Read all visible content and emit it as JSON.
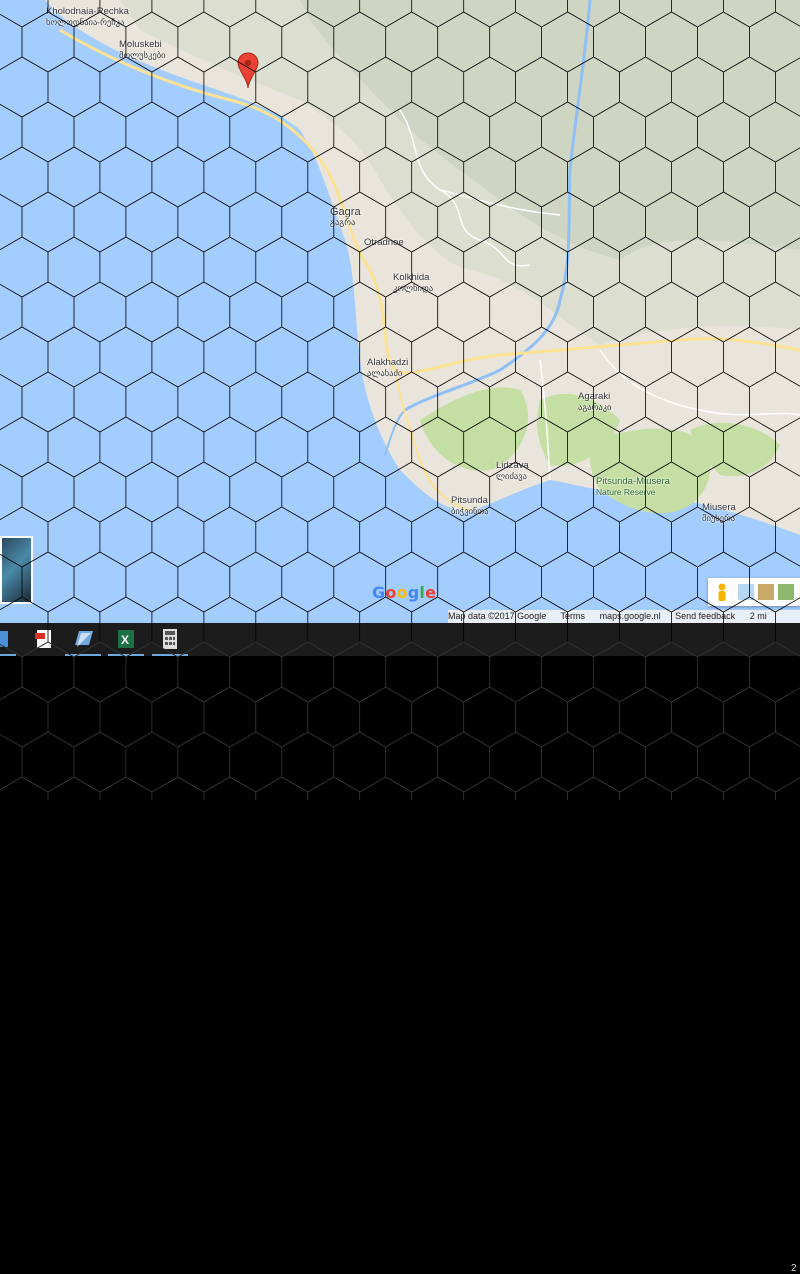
{
  "map": {
    "places": [
      {
        "id": "kholodnaia-rechka",
        "name": "Kholodnaia-Rechka",
        "local": "ხოლოდნაია-რეჩკა"
      },
      {
        "id": "moluskebi",
        "name": "Moluskebi",
        "local": "მოლუსკები"
      },
      {
        "id": "gagra",
        "name": "Gagra",
        "local": "გაგრა"
      },
      {
        "id": "otradnoe",
        "name": "Otradnoe",
        "local": ""
      },
      {
        "id": "kolkhida",
        "name": "Kolkhida",
        "local": "კოლხიდა"
      },
      {
        "id": "alakhadzi",
        "name": "Alakhadzi",
        "local": "ალახაძი"
      },
      {
        "id": "agaraki",
        "name": "Agaraki",
        "local": "აგარაკი"
      },
      {
        "id": "lidzava",
        "name": "Lidzava",
        "local": "ლიძავა"
      },
      {
        "id": "pitsunda",
        "name": "Pitsunda",
        "local": "ბიჭვინთა"
      },
      {
        "id": "pitsunda-miusera",
        "name": "Pitsunda-Miusera",
        "local": "Nature Reserve"
      },
      {
        "id": "miusera",
        "name": "Miusera",
        "local": "მიუსერა"
      }
    ],
    "marker": "red-pin-icon",
    "logo": "Google",
    "logo_colors": [
      "#4285F4",
      "#EA4335",
      "#FBBC05",
      "#4285F4",
      "#34A853",
      "#EA4335"
    ],
    "attribution": {
      "map_data": "Map data ©2017 Google",
      "terms": "Terms",
      "site": "maps.google.nl",
      "feedback": "Send feedback",
      "scale": "2 mi"
    },
    "colors": {
      "water": "#a3ccff",
      "land": "#e9e5dc",
      "park": "#c5dea3",
      "road": "#fde293"
    }
  },
  "taskbar": {
    "apps": [
      "file-explorer-icon",
      "pdf-icon",
      "files-icon",
      "excel-icon",
      "calculator-icon"
    ],
    "clock": "2"
  },
  "overlay": {
    "grid": "hexagon",
    "line_color": "#000000"
  }
}
